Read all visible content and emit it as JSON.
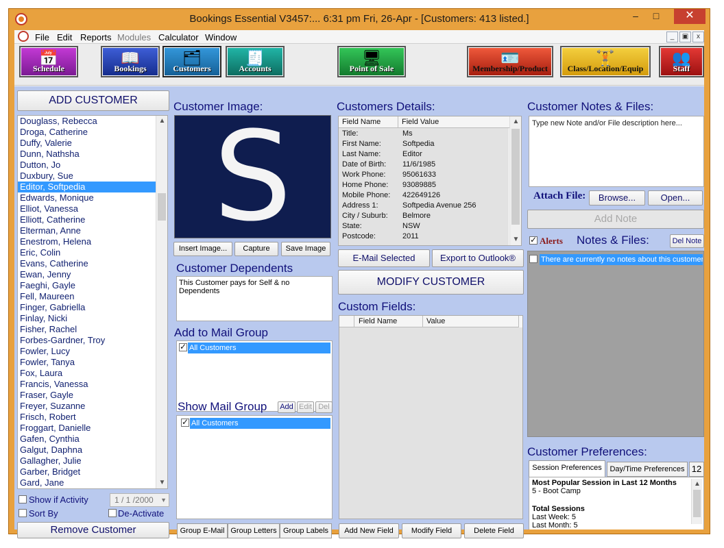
{
  "window": {
    "title": "Bookings Essential V3457:... 6:31 pm  Fri, 26-Apr - [Customers: 413 listed.]",
    "minimize": "–",
    "maximize": "□",
    "close": "✕"
  },
  "menu": {
    "items": [
      "File",
      "Edit",
      "Reports",
      "Modules",
      "Calculator",
      "Window"
    ],
    "mdi": [
      "_",
      "▣",
      "x"
    ]
  },
  "toolbar": {
    "schedule": "Schedule",
    "bookings": "Bookings",
    "customers": "Customers",
    "accounts": "Accounts",
    "pos": "Point of Sale",
    "membership": "Membership/Product",
    "classloc": "Class/Location/Equip",
    "staff": "Staff"
  },
  "left": {
    "add_customer": "ADD CUSTOMER",
    "customers": [
      "Douglass, Rebecca",
      "Droga, Catherine",
      "Duffy, Valerie",
      "Dunn, Nathsha",
      "Dutton, Jo",
      "Duxbury, Sue",
      "Editor, Softpedia",
      "Edwards, Monique",
      "Elliot, Vanessa",
      "Elliott, Catherine",
      "Elterman, Anne",
      "Enestrom, Helena",
      "Eric, Colin",
      "Evans, Catherine",
      "Ewan, Jenny",
      "Faeghi, Gayle",
      "Fell, Maureen",
      "Finger, Gabriella",
      "Finlay, Nicki",
      "Fisher, Rachel",
      "Forbes-Gardner, Troy",
      "Fowler, Lucy",
      "Fowler, Tanya",
      "Fox, Laura",
      "Francis, Vanessa",
      "Fraser, Gayle",
      "Freyer, Suzanne",
      "Frisch, Robert",
      "Froggart, Danielle",
      "Gafen, Cynthia",
      "Galgut, Daphna",
      "Gallagher, Julie",
      "Garber, Bridget",
      "Gard, Jane"
    ],
    "selected_index": 6,
    "show_if_activity": "Show if Activity",
    "activity_date": "1 / 1 /2000",
    "sort_by": "Sort By",
    "deactivate": "De-Activate",
    "remove_customer": "Remove Customer"
  },
  "image_panel": {
    "title": "Customer Image:",
    "letter": "S",
    "insert": "Insert Image...",
    "capture": "Capture",
    "save": "Save Image"
  },
  "dependents": {
    "title": "Customer Dependents",
    "text": "This Customer pays for Self & no Dependents"
  },
  "mail_group": {
    "title": "Add to Mail Group",
    "item": "All Customers"
  },
  "show_mail_group": {
    "title": "Show Mail Group",
    "add": "Add",
    "edit": "Edit",
    "del": "Del",
    "item": "All Customers"
  },
  "bottom_tabs": [
    "Group E-Mail",
    "Group Letters",
    "Group Labels"
  ],
  "details": {
    "title": "Customers Details:",
    "col_name": "Field Name",
    "col_value": "Field Value",
    "rows": [
      {
        "name": "Title:",
        "value": "Ms"
      },
      {
        "name": "First Name:",
        "value": "Softpedia"
      },
      {
        "name": "Last Name:",
        "value": "Editor"
      },
      {
        "name": "Date of Birth:",
        "value": "11/6/1985"
      },
      {
        "name": "Work Phone:",
        "value": "95061633"
      },
      {
        "name": "Home Phone:",
        "value": "93089885"
      },
      {
        "name": "Mobile Phone:",
        "value": "422649126"
      },
      {
        "name": "Address 1:",
        "value": "Softpedia Avenue 256"
      },
      {
        "name": "City / Suburb:",
        "value": "Belmore"
      },
      {
        "name": "State:",
        "value": "NSW"
      },
      {
        "name": "Postcode:",
        "value": "2011"
      }
    ],
    "email_selected": "E-Mail Selected",
    "export_outlook": "Export to Outlook®",
    "modify": "MODIFY CUSTOMER"
  },
  "custom_fields": {
    "title": "Custom Fields:",
    "col_name": "Field Name",
    "col_value": "Value",
    "add": "Add New Field",
    "modify": "Modify Field",
    "delete": "Delete Field"
  },
  "notes": {
    "title": "Customer Notes & Files:",
    "placeholder": "Type new Note and/or File description here...",
    "attach_file": "Attach File:",
    "browse": "Browse...",
    "open": "Open...",
    "add_note": "Add Note",
    "alerts": "Alerts",
    "notes_files": "Notes & Files:",
    "del_note": "Del Note",
    "empty": "There are currently no notes about this customer."
  },
  "preferences": {
    "title": "Customer Preferences:",
    "tabs": [
      "Session Preferences",
      "Day/Time Preferences",
      "12"
    ],
    "popular_title": "Most Popular Session in Last 12 Months",
    "popular_value": "5 - Boot Camp",
    "total_title": "Total Sessions",
    "last_week": "Last Week: 5",
    "last_month": "Last Month: 5"
  },
  "colors": {
    "frame": "#e8a13e",
    "panel_bg": "#b9c9ee",
    "heading": "#10107a",
    "selection": "#3399ff",
    "image_bg": "#0f1d4f"
  }
}
